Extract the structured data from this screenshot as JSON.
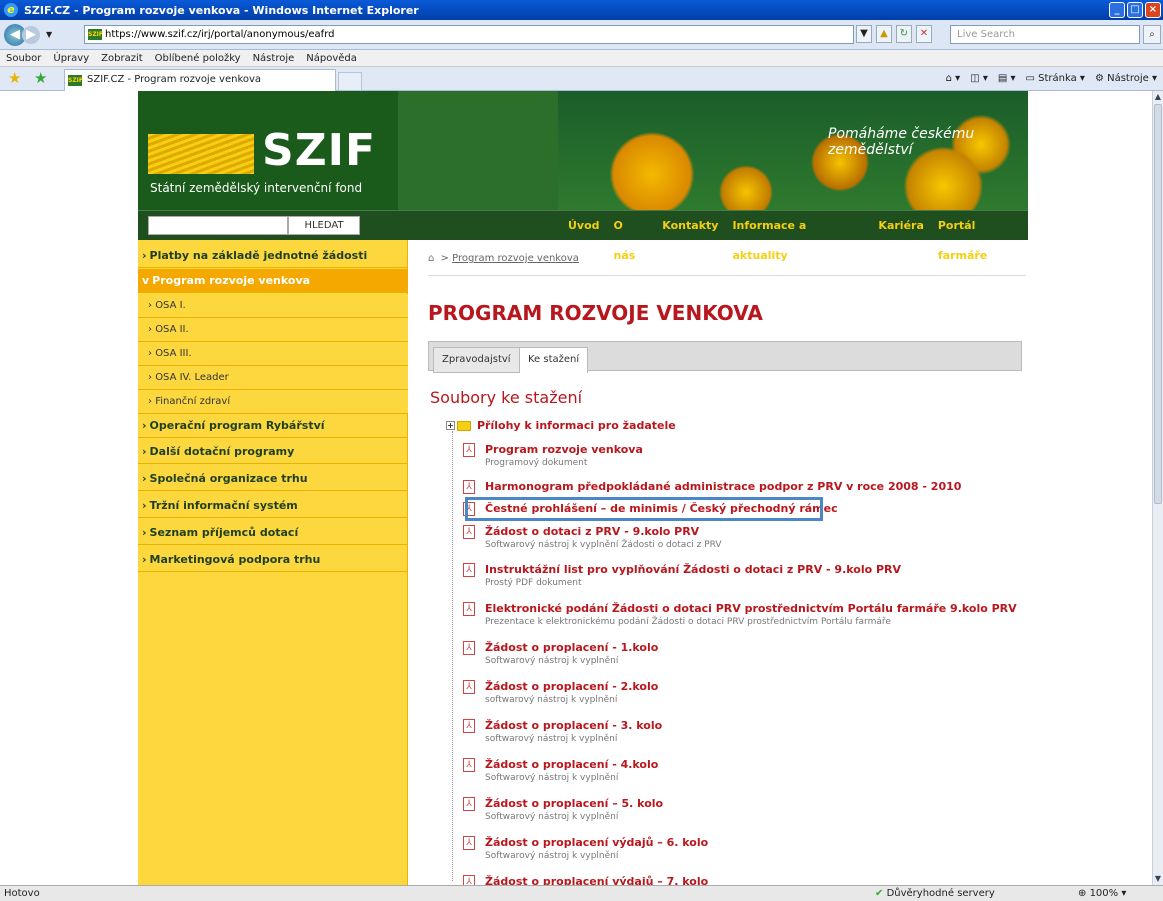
{
  "browser": {
    "window_title": "SZIF.CZ - Program rozvoje venkova - Windows Internet Explorer",
    "url": "https://www.szif.cz/irj/portal/anonymous/eafrd",
    "search_placeholder": "Live Search",
    "favicon_text": "SZIF",
    "menu": [
      "Soubor",
      "Úpravy",
      "Zobrazit",
      "Oblíbené položky",
      "Nástroje",
      "Nápověda"
    ],
    "tab_title": "SZIF.CZ - Program rozvoje venkova",
    "cmd_page": "Stránka",
    "cmd_tools": "Nástroje",
    "status_text": "Hotovo",
    "status_trust": "Důvěryhodné servery",
    "zoom": "100%"
  },
  "header": {
    "logo": "SZIF",
    "subtitle": "Státní zemědělský intervenční fond",
    "slogan": "Pomáháme českému zemědělství",
    "search_button": "HLEDAT",
    "nav": [
      "Úvod",
      "O nás",
      "Kontakty",
      "Informace a aktuality",
      "Kariéra",
      "Portál farmáře"
    ]
  },
  "sidebar": {
    "items": [
      {
        "label": "Platby na základě jednotné žádosti",
        "arrow": "›"
      },
      {
        "label": "Program rozvoje venkova",
        "arrow": "v"
      },
      {
        "label": "OSA I.",
        "arrow": "›"
      },
      {
        "label": "OSA II.",
        "arrow": "›"
      },
      {
        "label": "OSA III.",
        "arrow": "›"
      },
      {
        "label": "OSA IV. Leader",
        "arrow": "›"
      },
      {
        "label": "Finanční zdraví",
        "arrow": "›"
      },
      {
        "label": "Operační program Rybářství",
        "arrow": "›"
      },
      {
        "label": "Další dotační programy",
        "arrow": "›"
      },
      {
        "label": "Společná organizace trhu",
        "arrow": "›"
      },
      {
        "label": "Tržní informační systém",
        "arrow": "›"
      },
      {
        "label": "Seznam příjemců dotací",
        "arrow": "›"
      },
      {
        "label": "Marketingová podpora trhu",
        "arrow": "›"
      }
    ]
  },
  "main": {
    "breadcrumb_sep": ">",
    "breadcrumb": "Program rozvoje venkova",
    "title": "PROGRAM ROZVOJE VENKOVA",
    "tabs": [
      "Zpravodajství",
      "Ke stažení"
    ],
    "files_heading": "Soubory ke stažení",
    "folder": "Přílohy k informaci pro žadatele",
    "files": [
      {
        "name": "Program rozvoje venkova",
        "desc": "Programový dokument"
      },
      {
        "name": "Harmonogram předpokládané administrace podpor z PRV v roce 2008 - 2010",
        "desc": ""
      },
      {
        "name": "Čestné prohlášení – de minimis / Český přechodný rámec",
        "desc": ""
      },
      {
        "name": "Žádost o dotaci z PRV - 9.kolo PRV",
        "desc": "Softwarový nástroj k vyplnění Žádosti o dotaci z PRV"
      },
      {
        "name": "Instruktážní list pro vyplňování Žádosti o dotaci z PRV - 9.kolo PRV",
        "desc": "Prostý PDF dokument"
      },
      {
        "name": "Elektronické podání Žádosti o dotaci PRV prostřednictvím Portálu farmáře 9.kolo PRV",
        "desc": "Prezentace k elektronickému podání Žádosti o dotaci PRV prostřednictvím Portálu farmáře"
      },
      {
        "name": "Žádost o proplacení - 1.kolo",
        "desc": "Softwarový nástroj k vyplnění"
      },
      {
        "name": "Žádost o proplacení - 2.kolo",
        "desc": "softwarový nástroj k vyplnění"
      },
      {
        "name": "Žádost o proplacení - 3. kolo",
        "desc": "softwarový nástroj k vyplnění"
      },
      {
        "name": "Žádost o proplacení - 4.kolo",
        "desc": "Softwarový nástroj k vyplnění"
      },
      {
        "name": "Žádost o proplacení – 5. kolo",
        "desc": "Softwarový nástroj k vyplnění"
      },
      {
        "name": "Žádost o proplacení výdajů – 6. kolo",
        "desc": "Softwarový nástroj k vyplnění"
      },
      {
        "name": "Žádost o proplacení výdajů – 7. kolo",
        "desc": ""
      }
    ]
  },
  "colors": {
    "accent": "#b8171d",
    "sidebar": "#fcd83e",
    "highlight": "#4a86c8"
  }
}
